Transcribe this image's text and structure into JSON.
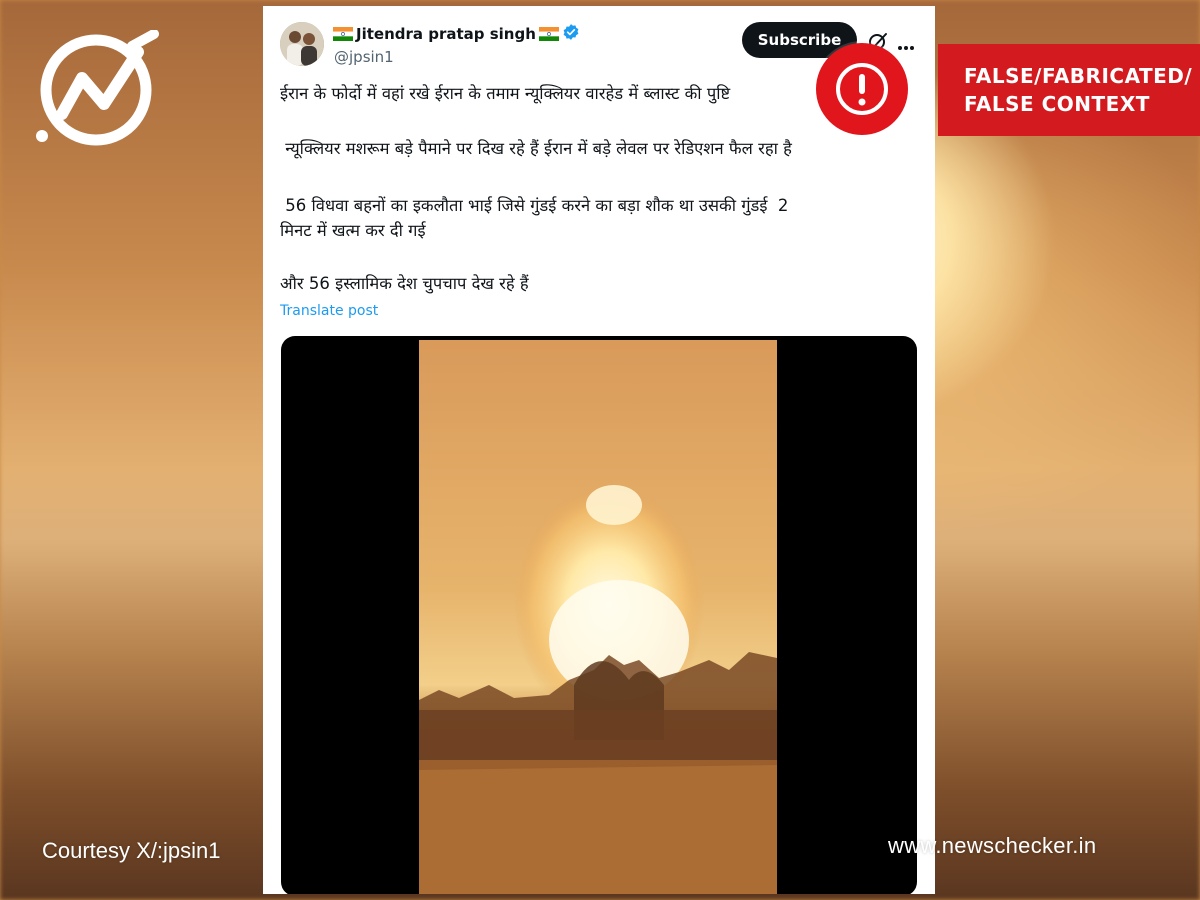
{
  "brand": {
    "logo_icon": "newschecker-logo-icon",
    "website": "www.newschecker.in",
    "courtesy": "Courtesy X/:jpsin1"
  },
  "verdict": {
    "icon": "exclamation-alert-icon",
    "label": "FALSE/FABRICATED/\nFALSE CONTEXT",
    "color": "#d31b1f"
  },
  "tweet": {
    "display_name": "Jitendra pratap singh",
    "verified": true,
    "handle": "@jpsin1",
    "subscribe_label": "Subscribe",
    "paragraphs": [
      "ईरान के फोर्दो में वहां रखे ईरान के तमाम न्यूक्लियर वारहेड में ब्लास्ट की पुष्टि",
      " न्यूक्लियर मशरूम बड़े पैमाने पर दिख रहे हैं ईरान में बड़े लेवल पर रेडिएशन फैल रहा है",
      " 56 विधवा बहनों का इकलौता भाई जिसे गुंडई करने का बड़ा शौक था उसकी गुंडई  2\nमिनट में खत्म कर दी गई",
      "और 56 इस्लामिक देश चुपचाप देख रहे हैं"
    ],
    "translate_label": "Translate post"
  },
  "colors": {
    "accent_link": "#1d9bf0",
    "verified_badge": "#1d9bf0",
    "alert_red": "#e0161c"
  }
}
